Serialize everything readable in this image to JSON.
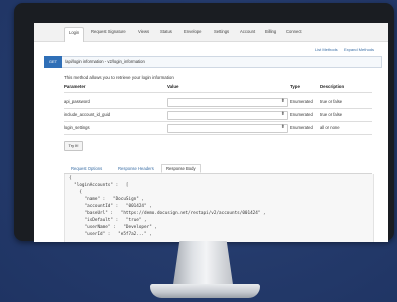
{
  "nav": {
    "items": [
      "Login",
      "Request Signature",
      "Views",
      "Status",
      "Envelope",
      "Settings",
      "Account",
      "Billing",
      "Connect"
    ],
    "active_index": 0
  },
  "links": {
    "list_methods": "List Methods",
    "expand_methods": "Expand Methods"
  },
  "method": {
    "verb": "GET",
    "path": "/api/login information - v2/login_information"
  },
  "description": "This method allows you to retrieve your login information",
  "params_table": {
    "headers": [
      "Parameter",
      "Value",
      "Type",
      "Description"
    ],
    "rows": [
      {
        "name": "api_password",
        "type": "Enumerated",
        "description": "true or false"
      },
      {
        "name": "include_account_id_guid",
        "type": "Enumerated",
        "description": "true or false"
      },
      {
        "name": "login_settings",
        "type": "Enumerated",
        "description": "all or none"
      }
    ]
  },
  "try_button": "Try It!",
  "response_tabs": [
    "Request Options",
    "Response Headers",
    "Response Body"
  ],
  "active_response_tab": 2,
  "code_lines": [
    "{",
    "  \"loginAccounts\" :   [",
    "    {",
    "      \"name\" :   \"DocuSign\" ,",
    "      \"accountId\" :   \"001424\" ,",
    "      \"baseUrl\" :   \"https://demo.docusign.net/restapi/v2/accounts/001424\" ,",
    "      \"isDefault\" :   \"true\" ,",
    "      \"userName\" :   \"Developer\" ,",
    "      \"userId\" :   \"e5f7a2...\" ,"
  ],
  "colors": {
    "background": "#243a6b",
    "get_badge": "#2f6fb7",
    "link": "#3a6ea5"
  }
}
